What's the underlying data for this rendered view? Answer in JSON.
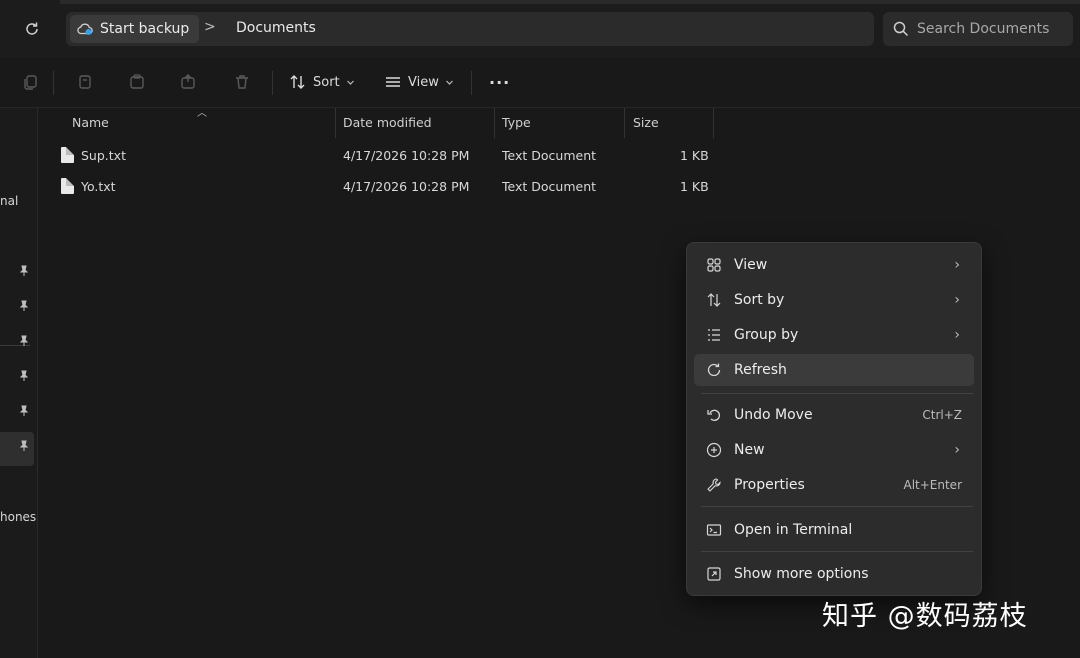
{
  "address": {
    "home_label": "Start backup",
    "separator": ">",
    "current_folder": "Documents"
  },
  "search": {
    "placeholder": "Search Documents"
  },
  "toolbar": {
    "sort_label": "Sort",
    "view_label": "View",
    "more_label": "···"
  },
  "sidebar": {
    "labels": [
      "nal",
      "hones"
    ]
  },
  "columns": [
    "Name",
    "Date modified",
    "Type",
    "Size"
  ],
  "files": [
    {
      "name": "Sup.txt",
      "date": "4/17/2026 10:28 PM",
      "type": "Text Document",
      "size": "1 KB"
    },
    {
      "name": "Yo.txt",
      "date": "4/17/2026 10:28 PM",
      "type": "Text Document",
      "size": "1 KB"
    }
  ],
  "context_menu": {
    "items": [
      {
        "label": "View",
        "icon": "grid-icon",
        "submenu": true
      },
      {
        "label": "Sort by",
        "icon": "sort-icon",
        "submenu": true
      },
      {
        "label": "Group by",
        "icon": "list-icon",
        "submenu": true
      },
      {
        "label": "Refresh",
        "icon": "refresh-icon",
        "highlighted": true
      },
      {
        "label": "Undo Move",
        "icon": "undo-icon",
        "shortcut": "Ctrl+Z"
      },
      {
        "label": "New",
        "icon": "plus-circle-icon",
        "submenu": true
      },
      {
        "label": "Properties",
        "icon": "wrench-icon",
        "shortcut": "Alt+Enter"
      },
      {
        "label": "Open in Terminal",
        "icon": "terminal-icon"
      },
      {
        "label": "Show more options",
        "icon": "expand-icon"
      }
    ]
  },
  "watermark": "知乎 @数码荔枝",
  "colors": {
    "background": "#191919",
    "menu_bg": "#2c2c2c",
    "menu_highlight": "#3b3b3b",
    "text": "#e6e6e6"
  }
}
